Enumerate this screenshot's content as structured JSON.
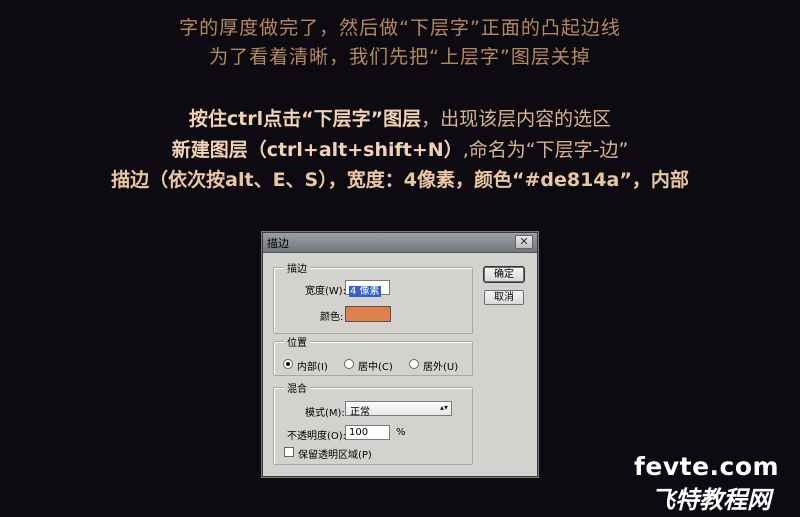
{
  "intro": {
    "line1": "字的厚度做完了，然后做“下层字”正面的凸起边线",
    "line2": "为了看着清晰，我们先把“上层字”图层关掉"
  },
  "steps": {
    "s1_bold": "按住ctrl点击“下层字”图层",
    "s1_normal": "，出现该层内容的选区",
    "s2_bold": "新建图层（ctrl+alt+shift+N）",
    "s2_normal": ",命名为“下层字-边”",
    "s3": "描边（依次按alt、E、S），宽度：4像素，颜色“#de814a”，内部"
  },
  "dialog": {
    "title": "描边",
    "close_glyph": "✕",
    "stroke_group": {
      "legend": "描边",
      "width_label": "宽度(W):",
      "width_value": "4 像素",
      "color_label": "颜色:",
      "color_hex": "#de814a"
    },
    "position_group": {
      "legend": "位置",
      "options": [
        "内部(I)",
        "居中(C)",
        "居外(U)"
      ],
      "selected": "内部(I)"
    },
    "blend_group": {
      "legend": "混合",
      "mode_label": "模式(M):",
      "mode_value": "正常",
      "opacity_label": "不透明度(O):",
      "opacity_value": "100",
      "opacity_unit": "%",
      "preserve_label": "保留透明区域(P)",
      "preserve_checked": false
    },
    "ok_label": "确定",
    "cancel_label": "取消"
  },
  "watermark": {
    "line1": "fevte.com",
    "line2": "飞特教程网"
  }
}
